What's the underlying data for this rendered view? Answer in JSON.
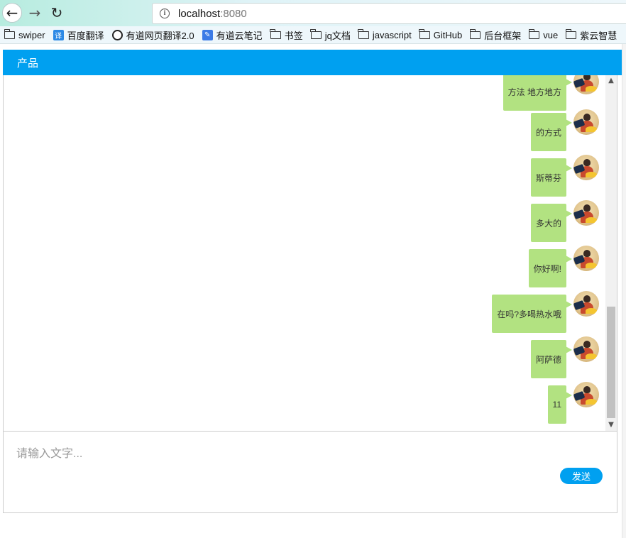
{
  "browser": {
    "url_host": "localhost",
    "url_port": ":8080",
    "bookmarks": [
      {
        "label": "swiper",
        "icon": "folder-icon"
      },
      {
        "label": "百度翻译",
        "icon": "translate-icon"
      },
      {
        "label": "有道网页翻译2.0",
        "icon": "globe-icon"
      },
      {
        "label": "有道云笔记",
        "icon": "note-icon"
      },
      {
        "label": "书签",
        "icon": "folder-icon"
      },
      {
        "label": "jq文档",
        "icon": "folder-icon"
      },
      {
        "label": "javascript",
        "icon": "folder-icon"
      },
      {
        "label": "GitHub",
        "icon": "folder-icon"
      },
      {
        "label": "后台框架",
        "icon": "folder-icon"
      },
      {
        "label": "vue",
        "icon": "folder-icon"
      },
      {
        "label": "紫云智慧",
        "icon": "folder-icon"
      }
    ]
  },
  "header": {
    "title": "产品"
  },
  "messages": [
    {
      "text": "方法 地方地方"
    },
    {
      "text": "的方式"
    },
    {
      "text": "斯蒂芬"
    },
    {
      "text": "多大的"
    },
    {
      "text": "你好啊!"
    },
    {
      "text": "在吗?多喝热水哦"
    },
    {
      "text": "阿萨德"
    },
    {
      "text": "11"
    }
  ],
  "composer": {
    "placeholder": "请输入文字...",
    "send_label": "发送"
  },
  "colors": {
    "header": "#00a0f0",
    "bubble": "#b2e281"
  }
}
